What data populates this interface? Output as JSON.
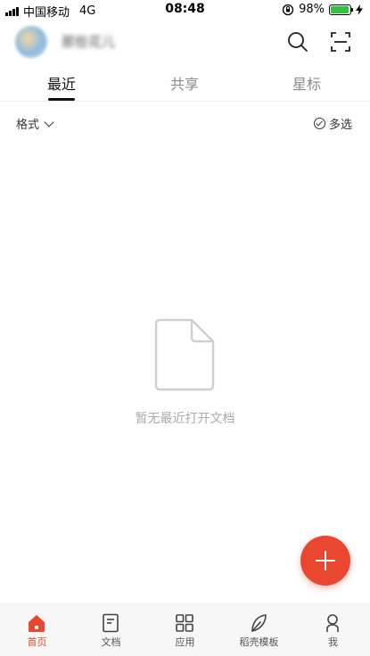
{
  "status_bar": {
    "carrier": "中国移动",
    "network": "4G",
    "time": "08:48",
    "battery_percent": "98%",
    "battery_level": 0.98
  },
  "header": {
    "username": "那些花儿",
    "search_icon": "search-icon",
    "scan_icon": "scan-icon"
  },
  "tabs": [
    {
      "label": "最近",
      "active": true
    },
    {
      "label": "共享",
      "active": false
    },
    {
      "label": "星标",
      "active": false
    }
  ],
  "filter": {
    "format_label": "格式",
    "multi_select_label": "多选"
  },
  "empty_state": {
    "icon": "document-icon",
    "text": "暂无最近打开文档"
  },
  "fab": {
    "icon": "plus-icon"
  },
  "bottom_nav": [
    {
      "label": "首页",
      "icon": "home-icon",
      "active": true
    },
    {
      "label": "文档",
      "icon": "document-icon",
      "active": false
    },
    {
      "label": "应用",
      "icon": "grid-icon",
      "active": false
    },
    {
      "label": "稻壳模板",
      "icon": "leaf-icon",
      "active": false
    },
    {
      "label": "我",
      "icon": "person-icon",
      "active": false
    }
  ],
  "colors": {
    "accent": "#e9472f",
    "battery": "#2ec43c"
  }
}
